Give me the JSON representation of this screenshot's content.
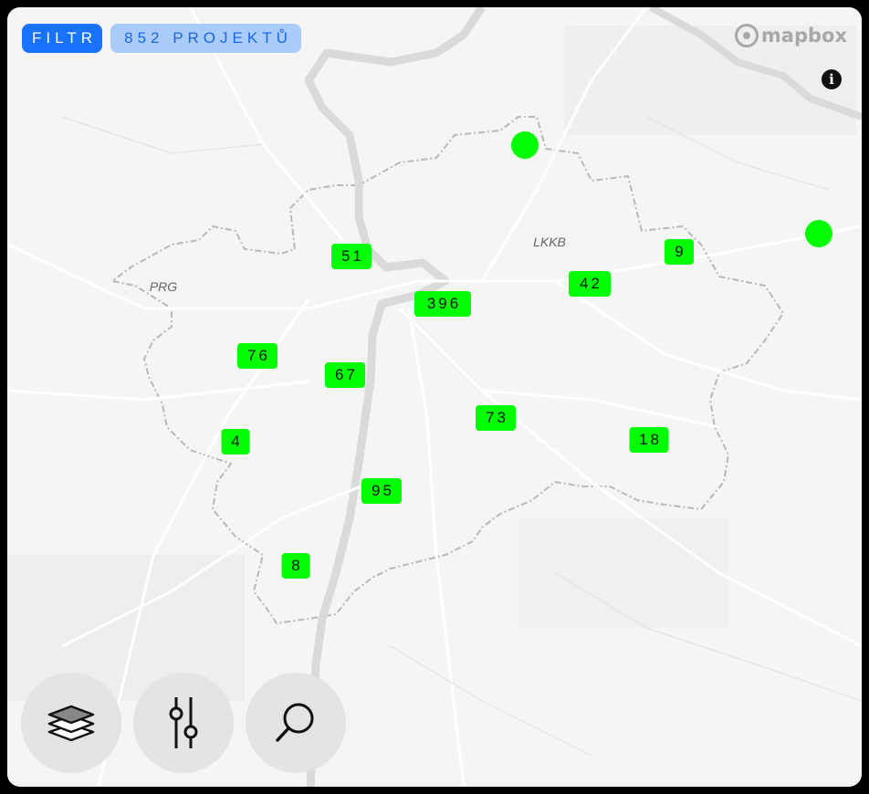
{
  "toolbar": {
    "filter_label": "FILTR",
    "count_label": "852 PROJEKTŮ"
  },
  "attribution": {
    "logo_text": "mapbox",
    "info_icon": "info-icon"
  },
  "map": {
    "place_labels": [
      {
        "text": "PRG"
      },
      {
        "text": "LKKB"
      }
    ],
    "clusters": [
      {
        "count": "51"
      },
      {
        "count": "396"
      },
      {
        "count": "42"
      },
      {
        "count": "9"
      },
      {
        "count": "76"
      },
      {
        "count": "67"
      },
      {
        "count": "4"
      },
      {
        "count": "73"
      },
      {
        "count": "18"
      },
      {
        "count": "95"
      },
      {
        "count": "8"
      }
    ],
    "single_points": 2,
    "marker_color": "#00ff00"
  },
  "controls": {
    "layers_icon": "layers-icon",
    "filter_icon": "sliders-icon",
    "search_icon": "search-icon"
  },
  "colors": {
    "accent": "#1a73ff",
    "accent_light": "#a9ccfa",
    "map_background": "#f5f5f5"
  }
}
